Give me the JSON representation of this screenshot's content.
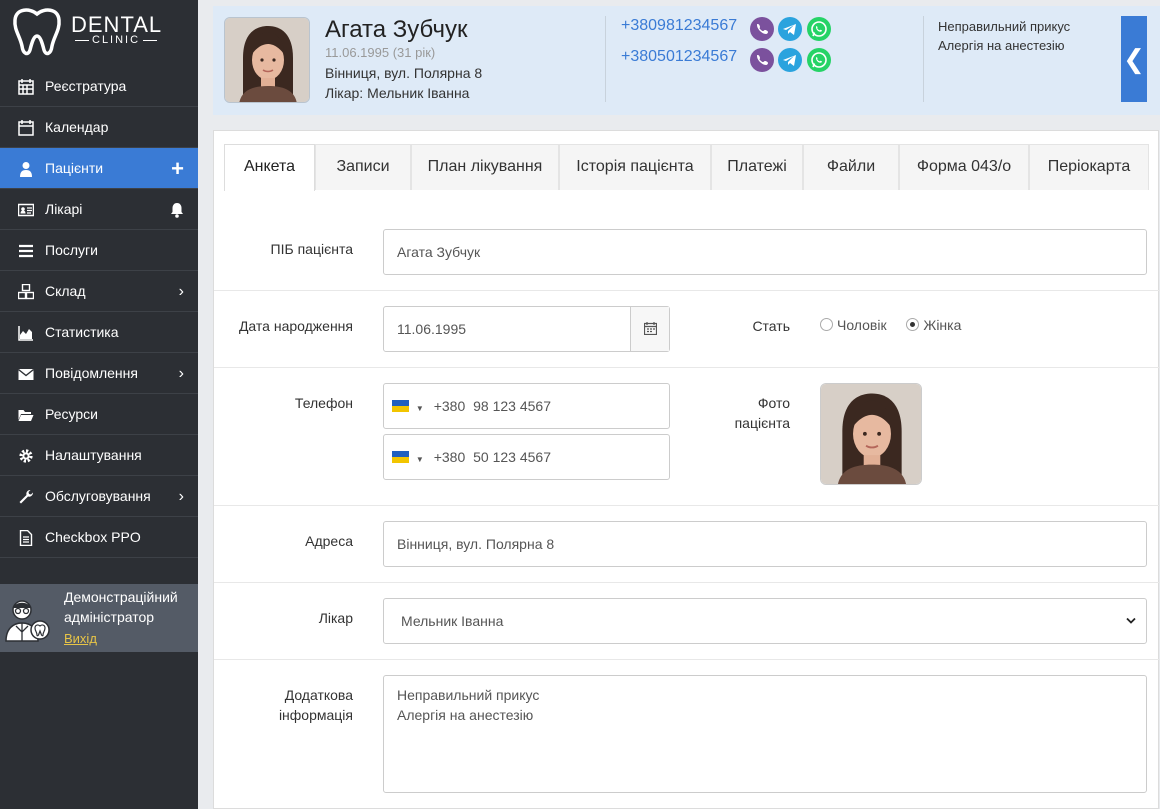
{
  "brand": {
    "name": "DENTAL",
    "sub": "CLINIC"
  },
  "sidebar": {
    "items": [
      {
        "label": "Реєстратура",
        "icon": "grid-calendar-icon"
      },
      {
        "label": "Календар",
        "icon": "calendar-icon"
      },
      {
        "label": "Пацієнти",
        "icon": "user-icon",
        "active": true
      },
      {
        "label": "Лікарі",
        "icon": "id-card-icon"
      },
      {
        "label": "Послуги",
        "icon": "list-icon"
      },
      {
        "label": "Склад",
        "icon": "cubes-icon"
      },
      {
        "label": "Статистика",
        "icon": "area-chart-icon"
      },
      {
        "label": "Повідомлення",
        "icon": "envelope-icon"
      },
      {
        "label": "Ресурси",
        "icon": "folder-open-icon"
      },
      {
        "label": "Налаштування",
        "icon": "gear-icon"
      },
      {
        "label": "Обслуговування",
        "icon": "wrench-icon"
      },
      {
        "label": "Checkbox PPO",
        "icon": "document-icon"
      }
    ],
    "user": {
      "name": "Демонстраційний адміністратор",
      "logout": "Вихід"
    }
  },
  "header": {
    "name": "Агата Зубчук",
    "dob": "11.06.1995 (31 рік)",
    "address": "Вінниця, вул. Полярна 8",
    "doctor": "Лікар: Мельник Іванна",
    "phones": [
      "+380981234567",
      "+380501234567"
    ],
    "notes": [
      "Неправильний прикус",
      "Алергія на анестезію"
    ]
  },
  "tabs": [
    "Анкета",
    "Записи",
    "План лікування",
    "Історія пацієнта",
    "Платежі",
    "Файли",
    "Форма 043/о",
    "Періокарта"
  ],
  "form": {
    "name_label": "ПІБ пацієнта",
    "name_value": "Агата Зубчук",
    "dob_label": "Дата народження",
    "dob_value": "11.06.1995",
    "sex_label": "Стать",
    "sex_male": "Чоловік",
    "sex_female": "Жінка",
    "phone_label": "Телефон",
    "phone_code": "+380",
    "phone1": "98 123 4567",
    "phone2": "50 123 4567",
    "photo_label": "Фото пацієнта",
    "address_label": "Адреса",
    "address_value": "Вінниця, вул. Полярна 8",
    "doctor_label": "Лікар",
    "doctor_value": "Мельник Іванна",
    "extra_label": "Додаткова інформація",
    "extra_value": "Неправильний прикус\nАлергія на анестезію"
  },
  "colors": {
    "accent": "#3a7bd5",
    "sidebar": "#2c2f34",
    "header_bg": "#deeaf7",
    "viber": "#7b519d",
    "telegram": "#2aa3de",
    "whatsapp": "#25d366"
  }
}
